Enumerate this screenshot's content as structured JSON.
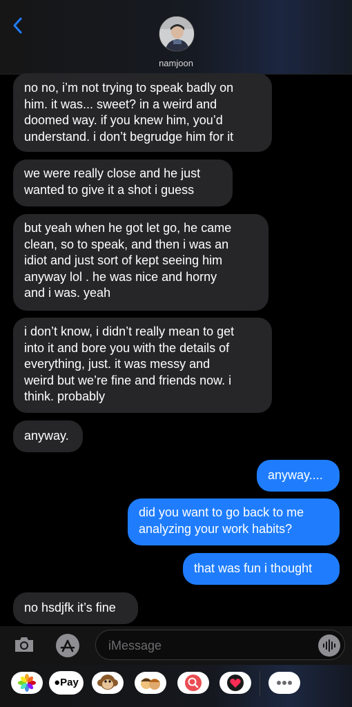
{
  "header": {
    "back_icon": "chevron-left-icon",
    "contact_name": "namjoon",
    "accent": "#1f7dfd"
  },
  "messages": [
    {
      "direction": "incoming",
      "lines": [
        "no no, i’m not trying to speak badly on",
        "him. it was... sweet? in a weird and",
        "doomed way. if you knew him, you’d",
        "understand. i don’t begrudge him for it"
      ]
    },
    {
      "direction": "incoming",
      "lines": [
        "we were really close and he just",
        "wanted to give it a shot i guess"
      ]
    },
    {
      "direction": "incoming",
      "lines": [
        "but yeah when he got let go, he came",
        "clean, so to speak, and then i was an",
        "idiot and just sort of kept seeing him",
        "anyway lol . he was nice and horny",
        "and i was. yeah"
      ]
    },
    {
      "direction": "incoming",
      "lines": [
        "i don’t know, i didn’t really mean to get",
        "into it and bore you with the details of",
        "everything, just. it was messy and",
        "weird but we’re fine and friends now.  i",
        "think. probably"
      ]
    },
    {
      "direction": "incoming",
      "lines": [
        "anyway."
      ]
    },
    {
      "direction": "outgoing",
      "lines": [
        "anyway...."
      ]
    },
    {
      "direction": "outgoing",
      "lines": [
        "did you want to go back to me",
        "analyzing your work habits?"
      ]
    },
    {
      "direction": "outgoing",
      "lines": [
        "that was fun i thought"
      ]
    },
    {
      "direction": "incoming",
      "lines": [
        "no hsdjfk it’s fine"
      ]
    }
  ],
  "composer": {
    "camera_icon": "camera-icon",
    "apps_icon": "app-store-icon",
    "placeholder": "iMessage",
    "audio_icon": "waveform-icon"
  },
  "tray": {
    "items": [
      {
        "name": "photos-icon"
      },
      {
        "name": "apple-pay-button",
        "label": "Pay"
      },
      {
        "name": "monkey-animoji-icon"
      },
      {
        "name": "memoji-icon"
      },
      {
        "name": "images-search-icon"
      },
      {
        "name": "digital-touch-icon"
      },
      {
        "name": "more-apps-icon"
      }
    ]
  },
  "colors": {
    "incoming_bubble": "#262628",
    "outgoing_bubble": "#1f7dfd",
    "background": "#000000"
  }
}
